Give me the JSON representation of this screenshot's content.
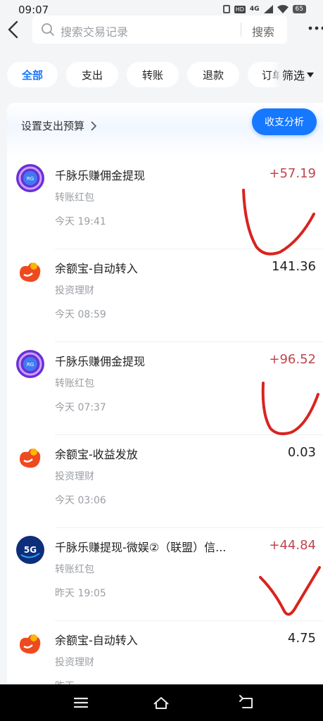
{
  "status_bar": {
    "time": "09:07",
    "hd": "HD",
    "network": "4G",
    "battery": "65"
  },
  "search": {
    "placeholder": "搜索交易记录",
    "button": "搜索"
  },
  "chips": [
    "全部",
    "支出",
    "转账",
    "退款",
    "订单"
  ],
  "filter_label": "筛选",
  "budget_label": "设置支出预算",
  "analysis_label": "收支分析",
  "colors": {
    "accent": "#1677ff",
    "income": "#c0444d",
    "annotation": "#d9231e"
  },
  "transactions": [
    {
      "icon": "qianmai-icon",
      "title": "千脉乐赚佣金提现",
      "category": "转账红包",
      "time": "今天 19:41",
      "amount": "+57.19"
    },
    {
      "icon": "yuebao-icon",
      "title": "余额宝-自动转入",
      "category": "投资理财",
      "time": "今天 08:59",
      "amount": "141.36"
    },
    {
      "icon": "qianmai-icon",
      "title": "千脉乐赚佣金提现",
      "category": "转账红包",
      "time": "今天 07:37",
      "amount": "+96.52"
    },
    {
      "icon": "yuebao-icon",
      "title": "余额宝-收益发放",
      "category": "投资理财",
      "time": "今天 03:06",
      "amount": "0.03"
    },
    {
      "icon": "5g-icon",
      "title": "千脉乐赚提现-微娱②（联盟）信...",
      "category": "转账红包",
      "time": "昨天 19:05",
      "amount": "+44.84"
    },
    {
      "icon": "yuebao-icon",
      "title": "余额宝-自动转入",
      "category": "投资理财",
      "time": "昨天",
      "amount": "4.75"
    }
  ]
}
